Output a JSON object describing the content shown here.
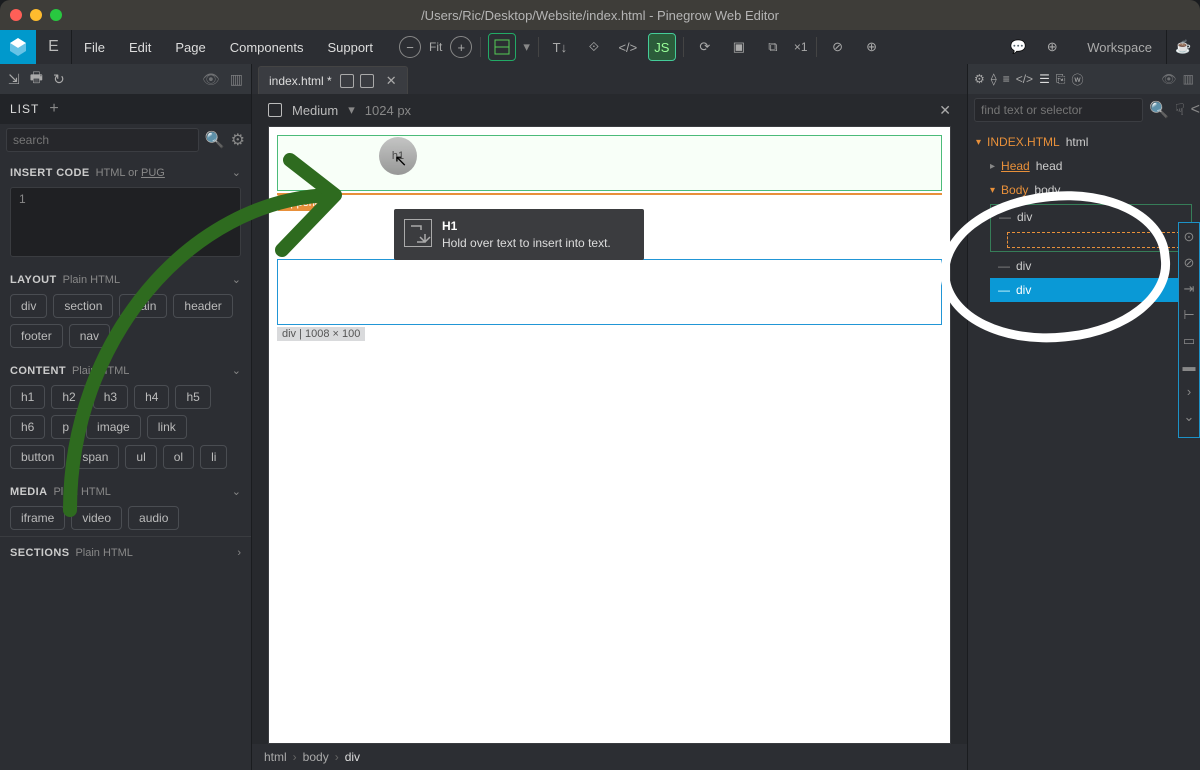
{
  "titlebar": {
    "path": "/Users/Ric/Desktop/Website/index.html - Pinegrow Web Editor"
  },
  "menu": {
    "file": "File",
    "edit": "Edit",
    "page": "Page",
    "components": "Components",
    "support": "Support",
    "fit": "Fit",
    "x1": "×1",
    "workspace": "Workspace"
  },
  "left": {
    "list_label": "LIST",
    "search_placeholder": "search",
    "insert_code": {
      "label": "INSERT CODE",
      "sub": "HTML or",
      "pug": "PUG",
      "line_no": "1"
    },
    "layout": {
      "label": "LAYOUT",
      "sub": "Plain HTML",
      "tags": [
        "div",
        "section",
        "main",
        "header",
        "footer",
        "nav"
      ]
    },
    "content": {
      "label": "CONTENT",
      "sub": "Plain HTML",
      "tags": [
        "h1",
        "h2",
        "h3",
        "h4",
        "h5",
        "h6",
        "p",
        "image",
        "link",
        "button",
        "span",
        "ul",
        "ol",
        "li"
      ]
    },
    "media": {
      "label": "MEDIA",
      "sub": "Plain HTML",
      "tags": [
        "iframe",
        "video",
        "audio"
      ]
    },
    "sections": {
      "label": "SECTIONS",
      "sub": "Plain HTML"
    }
  },
  "center": {
    "tab_label": "index.html *",
    "viewport_label": "Medium",
    "viewport_px": "1024 px",
    "append": "Append",
    "drag_label": "h1",
    "tooltip_title": "H1",
    "tooltip_body": "Hold over text to insert into text.",
    "bluebox_label": "div | 1008 × 100",
    "breadcrumbs": [
      "html",
      "body",
      "div"
    ]
  },
  "right": {
    "search_placeholder": "find text or selector",
    "root_file": "INDEX.HTML",
    "root_tag": "html",
    "head_label": "Head",
    "head_tag": "head",
    "body_label": "Body",
    "body_tag": "body",
    "div": "div"
  }
}
